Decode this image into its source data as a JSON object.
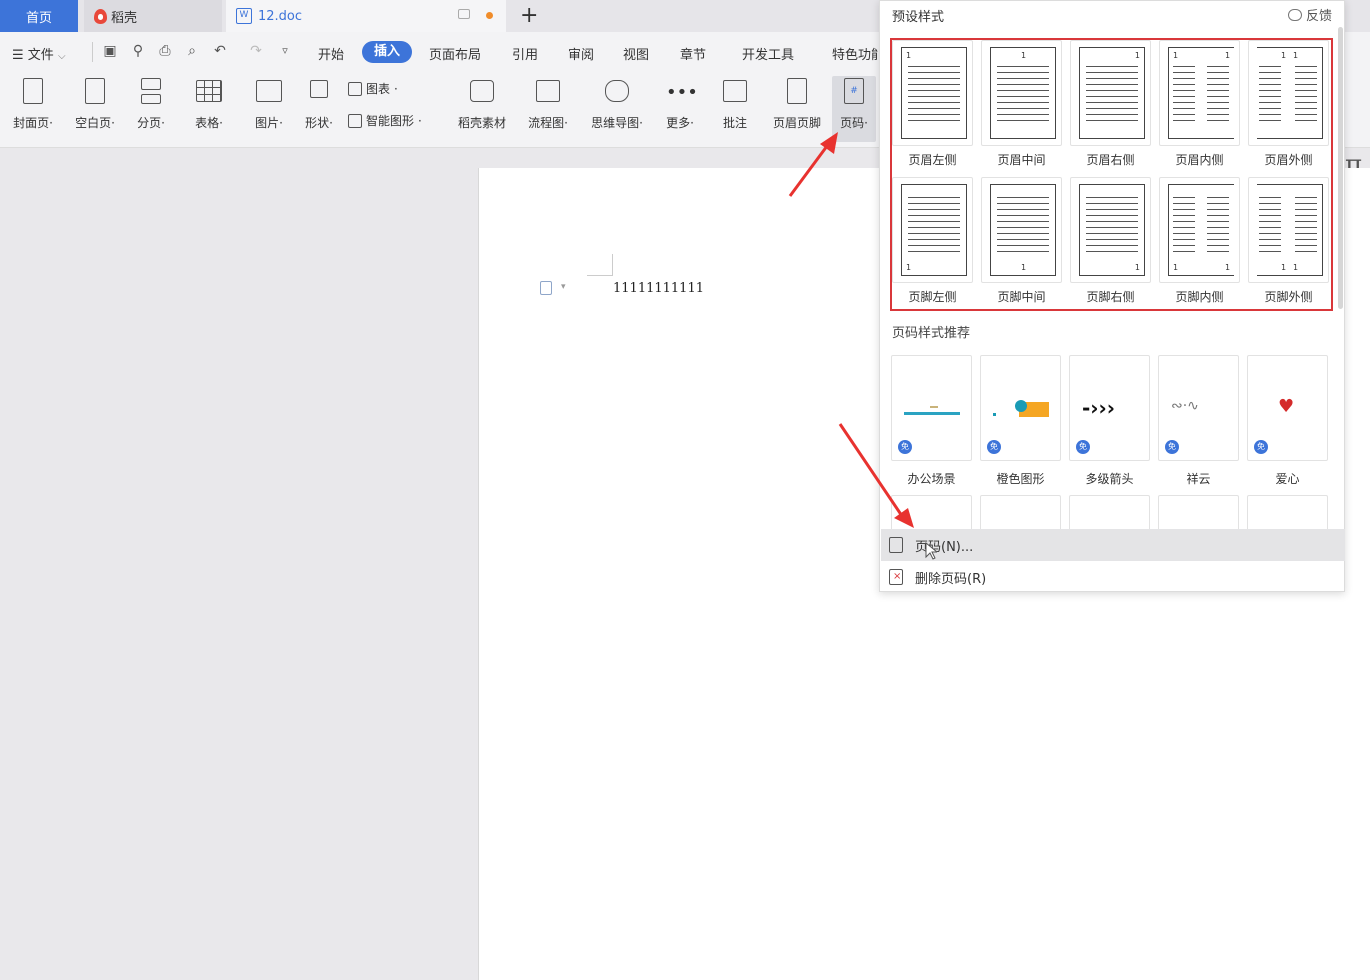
{
  "tabs": {
    "home": "首页",
    "daoke": "稻壳",
    "doc": "12.doc",
    "new_tab": "+"
  },
  "menu": {
    "file": "文件",
    "items": [
      "开始",
      "插入",
      "页面布局",
      "引用",
      "审阅",
      "视图",
      "章节",
      "开发工具",
      "特色功能"
    ]
  },
  "ribbon": {
    "cover": "封面页",
    "blank": "空白页",
    "pagebreak": "分页",
    "table": "表格",
    "picture": "图片",
    "shape": "形状",
    "chart": "图表",
    "smartart": "智能图形",
    "material": "稻壳素材",
    "flowchart": "流程图",
    "mindmap": "思维导图",
    "more": "更多",
    "comment": "批注",
    "header_footer": "页眉页脚",
    "page_number": "页码",
    "formula_partial": "式"
  },
  "document": {
    "text": "11111111111"
  },
  "dropdown": {
    "title": "预设样式",
    "feedback": "反馈",
    "presets": [
      {
        "label": "页眉左侧",
        "num": "1"
      },
      {
        "label": "页眉中间",
        "num": "1"
      },
      {
        "label": "页眉右侧",
        "num": "1"
      },
      {
        "label": "页眉内侧",
        "num": "1"
      },
      {
        "label": "页眉外侧",
        "num": "1"
      },
      {
        "label": "页脚左侧",
        "num": "1"
      },
      {
        "label": "页脚中间",
        "num": "1"
      },
      {
        "label": "页脚右侧",
        "num": "1"
      },
      {
        "label": "页脚内侧",
        "num": "1"
      },
      {
        "label": "页脚外侧",
        "num": "1"
      }
    ],
    "recommend_title": "页码样式推荐",
    "recommend": [
      {
        "label": "办公场景",
        "badge": "免"
      },
      {
        "label": "橙色图形",
        "badge": "免"
      },
      {
        "label": "多级箭头",
        "badge": "免"
      },
      {
        "label": "祥云",
        "badge": "免"
      },
      {
        "label": "爱心",
        "badge": "免"
      }
    ],
    "page_number_item": "页码(N)...",
    "delete_item": "删除页码(R)"
  },
  "colors": {
    "accent": "#3d74d9",
    "highlight_box": "#d9373a",
    "arrow": "#e8322f"
  }
}
